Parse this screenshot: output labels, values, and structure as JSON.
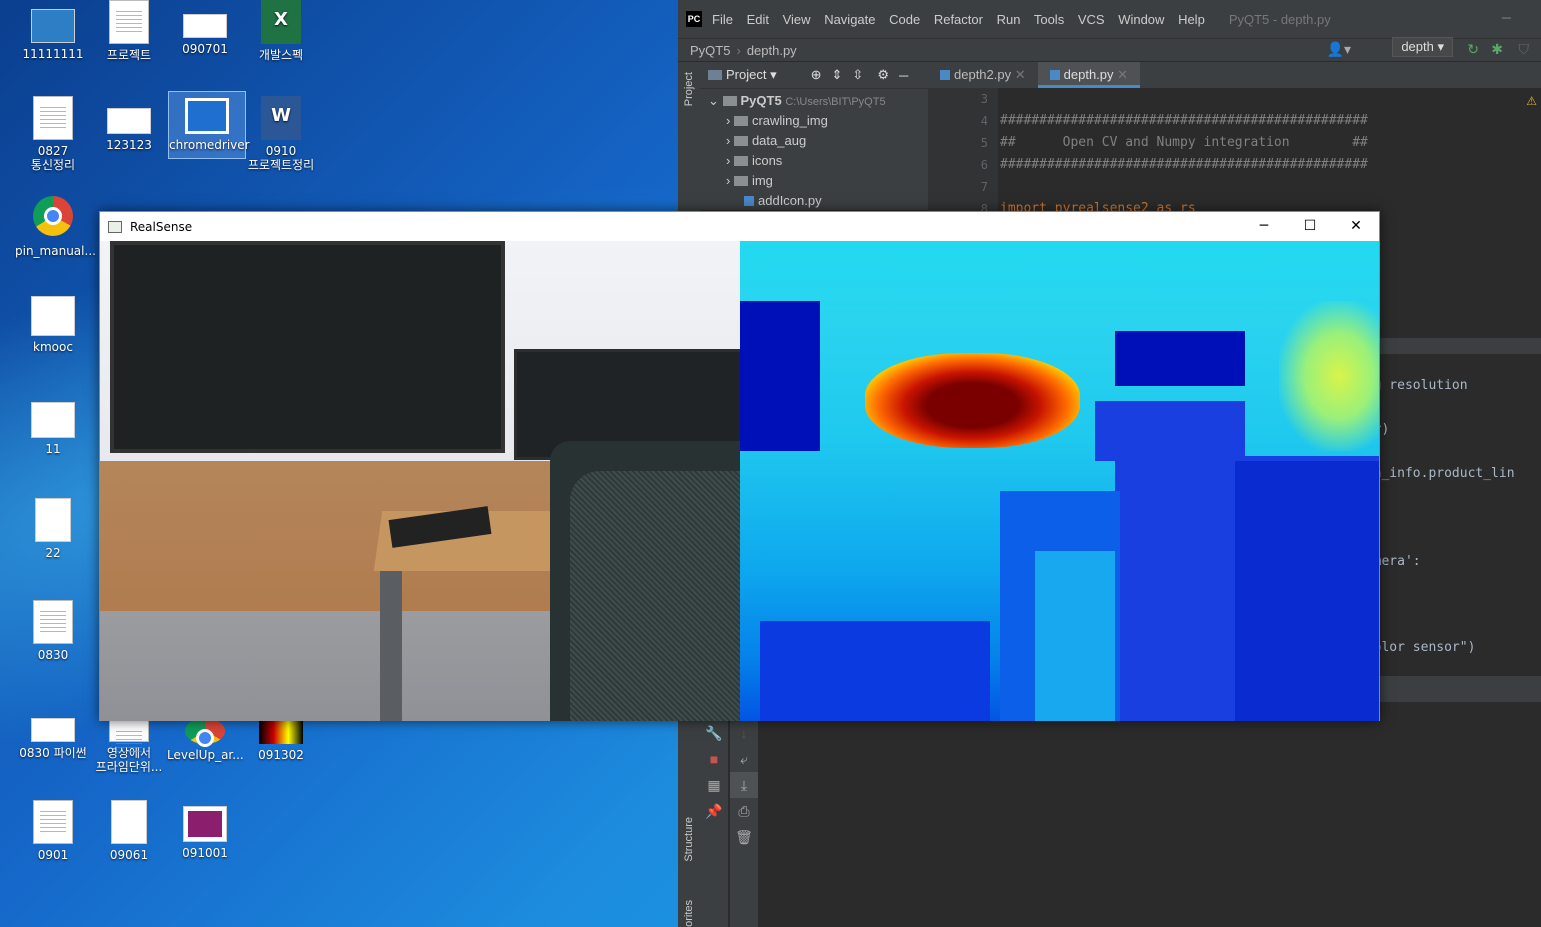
{
  "desktop": {
    "icons": [
      {
        "label": "11111111"
      },
      {
        "label": "프로젝트"
      },
      {
        "label": "090701"
      },
      {
        "label": "개발스펙"
      },
      {
        "label": "0827\n통신정리"
      },
      {
        "label": "123123"
      },
      {
        "label": "chromedriver"
      },
      {
        "label": "0910\n프로젝트정리"
      },
      {
        "label": "pin_manual..."
      },
      {
        "label": "kmooc"
      },
      {
        "label": "11"
      },
      {
        "label": "22"
      },
      {
        "label": "0830"
      },
      {
        "label": "0830 파이썬"
      },
      {
        "label": "영상에서\n프라임단위..."
      },
      {
        "label": "LevelUp_ar..."
      },
      {
        "label": "091302"
      },
      {
        "label": "0901"
      },
      {
        "label": "09061"
      },
      {
        "label": "091001"
      }
    ]
  },
  "ide": {
    "logo": "PC",
    "menu": [
      "File",
      "Edit",
      "View",
      "Navigate",
      "Code",
      "Refactor",
      "Run",
      "Tools",
      "VCS",
      "Window",
      "Help"
    ],
    "window_title": "PyQT5 - depth.py",
    "breadcrumb": [
      "PyQT5",
      "depth.py"
    ],
    "run_config": "depth",
    "side_labels": {
      "project": "Project",
      "structure": "Structure",
      "favorites": "orites"
    },
    "project_panel": {
      "header": "Project",
      "root": {
        "name": "PyQT5",
        "path": "C:\\Users\\BIT\\PyQT5"
      },
      "items": [
        "crawling_img",
        "data_aug",
        "icons",
        "img",
        "addIcon.py"
      ]
    },
    "tabs": [
      {
        "label": "depth2.py"
      },
      {
        "label": "depth.py"
      }
    ],
    "gutter": [
      "3",
      "4",
      "5",
      "6",
      "7",
      "8"
    ],
    "code_lines": [
      "",
      "###############################################",
      "##      Open CV and Numpy integration        ##",
      "###############################################",
      "",
      "import pyrealsense2 as rs"
    ],
    "obscured_code": [
      "ing resolution",
      "ber)",
      "era_info.product_lin",
      "Camera':",
      "'Color sensor\")"
    ]
  },
  "realsense": {
    "title": "RealSense",
    "controls": {
      "minimize": "─",
      "maximize": "☐",
      "close": "✕"
    }
  },
  "colors": {
    "ide_bg": "#2b2b2b",
    "accent": "#4a88c7"
  }
}
